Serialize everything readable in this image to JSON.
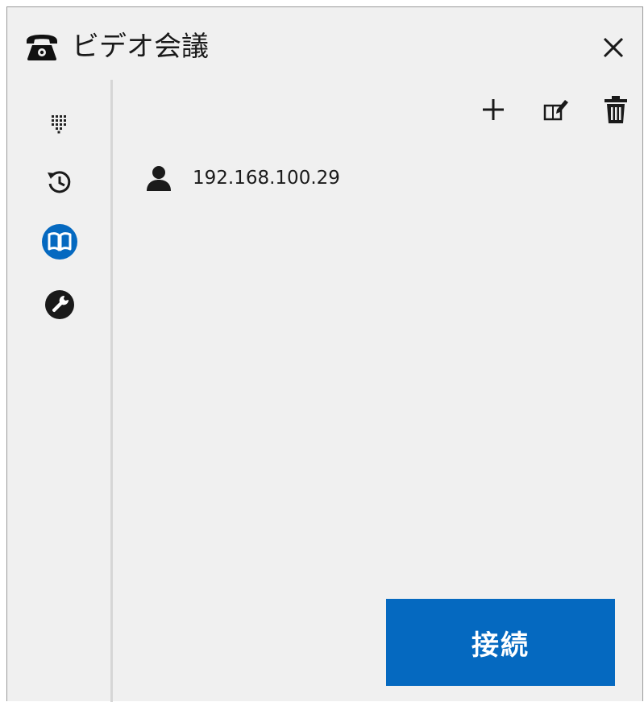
{
  "window": {
    "title": "ビデオ会議"
  },
  "icons": {
    "title_icon": "telephone-icon",
    "close": "close-icon",
    "dialpad": "dialpad-icon",
    "history": "history-icon",
    "contacts": "address-book-icon",
    "settings": "wrench-icon",
    "add": "add-icon",
    "edit": "edit-icon",
    "delete": "trash-icon",
    "contact": "person-icon"
  },
  "sidebar": {
    "active_item": "contacts"
  },
  "contacts": [
    {
      "name": "192.168.100.29"
    }
  ],
  "footer": {
    "connect_label": "接続"
  },
  "colors": {
    "accent": "#0569c0",
    "background": "#f0f0f0",
    "text": "#1a1a1a",
    "divider": "#d6d6d6"
  }
}
